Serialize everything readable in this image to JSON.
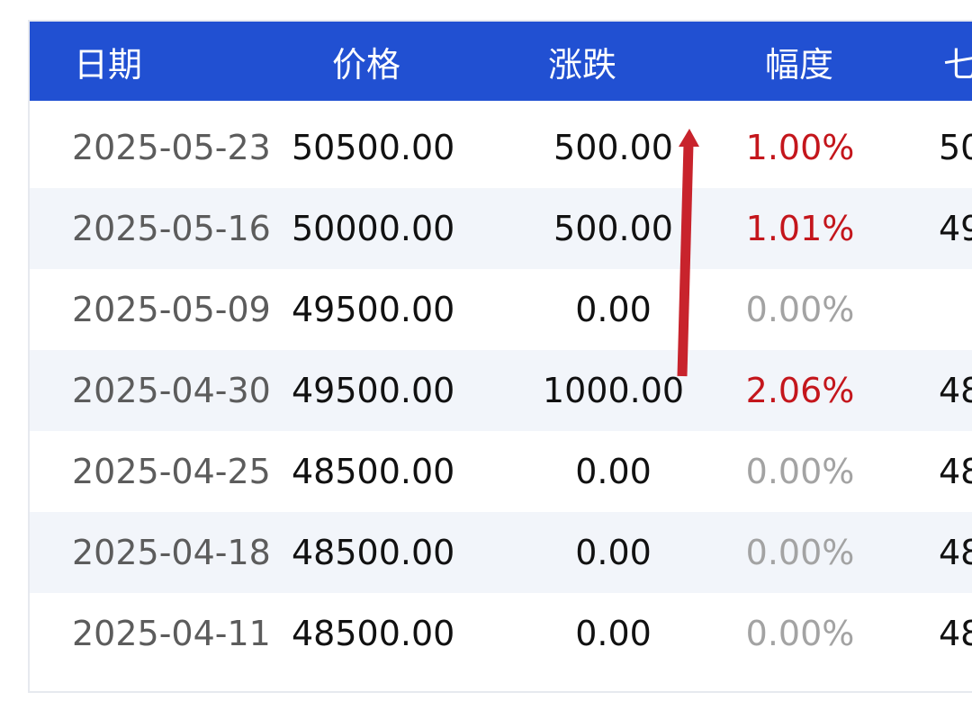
{
  "table": {
    "headers": {
      "date": "日期",
      "price": "价格",
      "change": "涨跌",
      "pct": "幅度",
      "extra": "七"
    },
    "rows": [
      {
        "date": "2025-05-23",
        "price": "50500.00",
        "change": "500.00",
        "pct": "1.00%",
        "extra": "50"
      },
      {
        "date": "2025-05-16",
        "price": "50000.00",
        "change": "500.00",
        "pct": "1.01%",
        "extra": "49"
      },
      {
        "date": "2025-05-09",
        "price": "49500.00",
        "change": "0.00",
        "pct": "0.00%",
        "extra": ""
      },
      {
        "date": "2025-04-30",
        "price": "49500.00",
        "change": "1000.00",
        "pct": "2.06%",
        "extra": "48"
      },
      {
        "date": "2025-04-25",
        "price": "48500.00",
        "change": "0.00",
        "pct": "0.00%",
        "extra": "48"
      },
      {
        "date": "2025-04-18",
        "price": "48500.00",
        "change": "0.00",
        "pct": "0.00%",
        "extra": "48"
      },
      {
        "date": "2025-04-11",
        "price": "48500.00",
        "change": "0.00",
        "pct": "0.00%",
        "extra": "48"
      }
    ]
  },
  "colors": {
    "header_bg": "#2150d2",
    "up": "#c4161c",
    "flat": "#a3a3a3",
    "arrow": "#c8232c"
  }
}
